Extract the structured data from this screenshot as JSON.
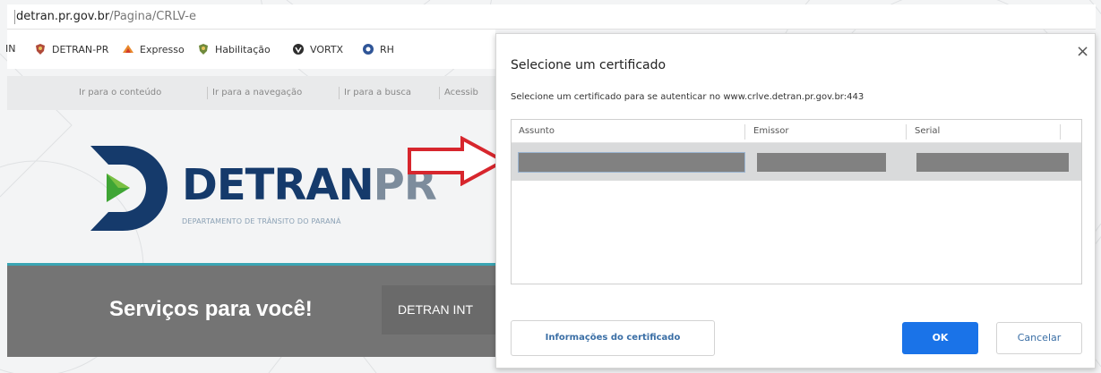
{
  "browser": {
    "url_host": "detran.pr.gov.br",
    "url_path": "/Pagina/CRLV-e",
    "bookmarks": [
      {
        "label": "IN",
        "icon": "none"
      },
      {
        "label": "DETRAN-PR",
        "icon": "coat-of-arms-icon"
      },
      {
        "label": "Expresso",
        "icon": "expresso-icon"
      },
      {
        "label": "Habilitação",
        "icon": "coat-of-arms-icon"
      },
      {
        "label": "VORTX",
        "icon": "vortx-icon"
      },
      {
        "label": "RH",
        "icon": "blue-circle-icon"
      }
    ]
  },
  "site": {
    "skip_links": [
      "Ir para o conteúdo",
      "Ir para a navegação",
      "Ir para a busca",
      "Acessib"
    ],
    "logo_main": "DETRAN",
    "logo_pr": "PR",
    "logo_subtitle": "DEPARTAMENTO DE TRÂNSITO DO PARANÁ",
    "services_title": "Serviços para você!",
    "services_button": "DETRAN INT"
  },
  "dialog": {
    "title": "Selecione um certificado",
    "subtitle": "Selecione um certificado para se autenticar no www.crlve.detran.pr.gov.br:443",
    "close_glyph": "×",
    "columns": [
      "Assunto",
      "Emissor",
      "Serial"
    ],
    "info_button": "Informações do certificado",
    "ok_button": "OK",
    "cancel_button": "Cancelar"
  },
  "colors": {
    "accent_blue": "#1a73e8",
    "arrow_red": "#d7262d",
    "logo_navy": "#153a6b",
    "logo_green": "#3fa535",
    "services_bar": "#747474",
    "teal_line": "#3aa5b3"
  }
}
